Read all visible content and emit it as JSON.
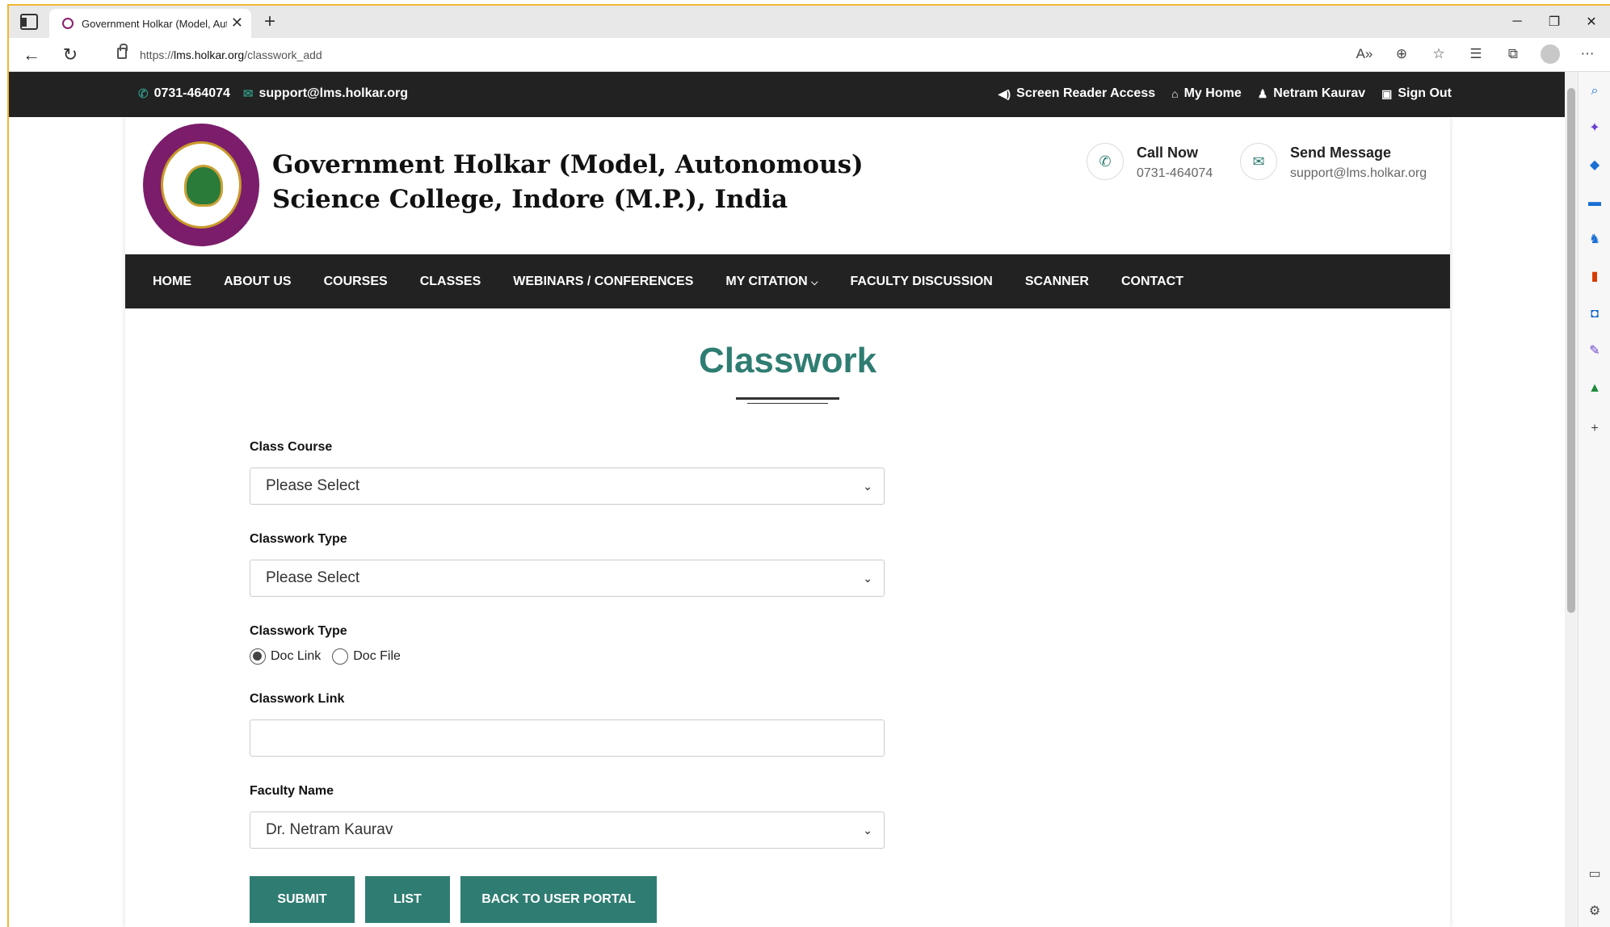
{
  "browser": {
    "tab_title": "Government Holkar (Model, Autonomous) Science College, Indore",
    "url_prefix": "https://",
    "url_host": "lms.holkar.org",
    "url_path": "/classwork_add"
  },
  "topbar": {
    "phone": "0731-464074",
    "email": "support@lms.holkar.org",
    "screen_reader": "Screen Reader Access",
    "my_home": "My Home",
    "user_name": "Netram Kaurav",
    "sign_out": "Sign Out"
  },
  "header": {
    "college_line1": "Government Holkar (Model, Autonomous)",
    "college_line2": "Science College, Indore (M.P.), India",
    "call_title": "Call Now",
    "call_value": "0731-464074",
    "msg_title": "Send Message",
    "msg_value": "support@lms.holkar.org"
  },
  "nav": {
    "items": [
      "HOME",
      "ABOUT US",
      "COURSES",
      "CLASSES",
      "WEBINARS / CONFERENCES",
      "MY CITATION",
      "FACULTY DISCUSSION",
      "SCANNER",
      "CONTACT"
    ]
  },
  "page": {
    "title": "Classwork"
  },
  "form": {
    "class_course_label": "Class Course",
    "class_course_value": "Please Select",
    "classwork_type_label": "Classwork Type",
    "classwork_type_value": "Please Select",
    "classwork_type2_label": "Classwork Type",
    "radio_doc_link": "Doc Link",
    "radio_doc_file": "Doc File",
    "radio_selected": "Doc Link",
    "classwork_link_label": "Classwork Link",
    "classwork_link_value": "",
    "faculty_label": "Faculty Name",
    "faculty_value": "Dr. Netram Kaurav",
    "submit_label": "SUBMIT",
    "list_label": "LIST",
    "back_label": "BACK TO USER PORTAL"
  },
  "colors": {
    "accent": "#2f7d72",
    "dark_bar": "#222222",
    "logo": "#7b1d6b"
  }
}
